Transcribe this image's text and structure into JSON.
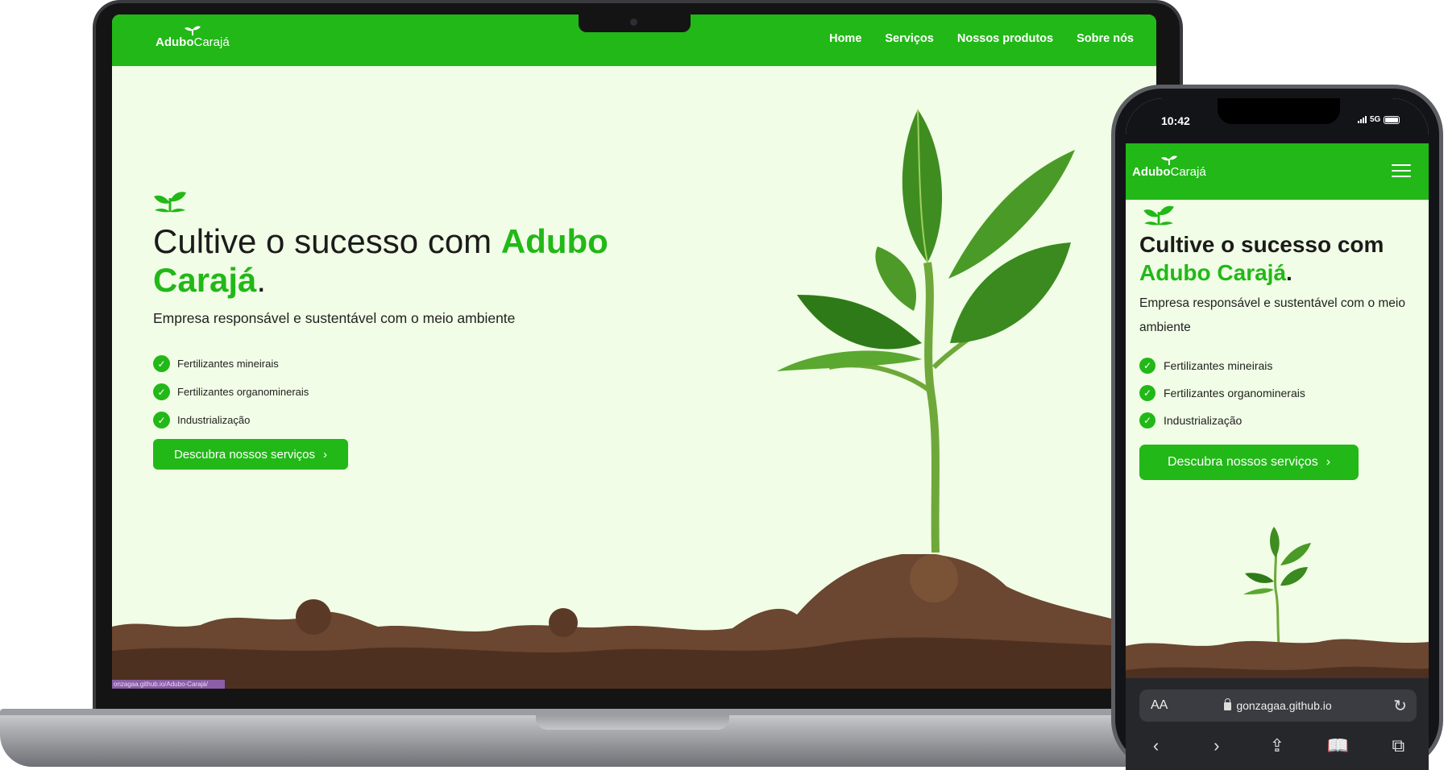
{
  "site": {
    "logo_bold": "Adubo",
    "logo_light": "Carajá",
    "nav_links": [
      "Home",
      "Serviços",
      "Nossos produtos",
      "Sobre nós"
    ],
    "title_plain": "Cultive o sucesso com ",
    "title_accent": "Adubo Carajá",
    "title_end": ".",
    "subtitle": "Empresa responsável e sustentável com o meio ambiente",
    "features": [
      "Fertilizantes mineirais",
      "Fertilizantes organominerais",
      "Industrialização"
    ],
    "cta_label": "Descubra nossos serviços",
    "cta_icon": "chevron-right-icon"
  },
  "laptop": {
    "status_url": "onzagaa.github.io/Adubo-Carajá/"
  },
  "phone": {
    "time": "10:42",
    "network": "5G",
    "browser": {
      "text_size_label": "AA",
      "url": "gonzagaa.github.io"
    }
  },
  "colors": {
    "brand_green": "#22b818",
    "hero_background": "#f1fde6",
    "text": "#1b1b1b"
  }
}
